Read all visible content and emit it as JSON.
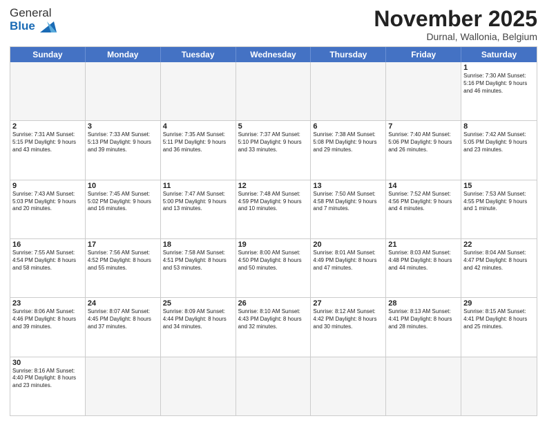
{
  "header": {
    "logo_general": "General",
    "logo_blue": "Blue",
    "month_title": "November 2025",
    "subtitle": "Durnal, Wallonia, Belgium"
  },
  "weekdays": [
    "Sunday",
    "Monday",
    "Tuesday",
    "Wednesday",
    "Thursday",
    "Friday",
    "Saturday"
  ],
  "rows": [
    [
      {
        "day": "",
        "info": "",
        "empty": true
      },
      {
        "day": "",
        "info": "",
        "empty": true
      },
      {
        "day": "",
        "info": "",
        "empty": true
      },
      {
        "day": "",
        "info": "",
        "empty": true
      },
      {
        "day": "",
        "info": "",
        "empty": true
      },
      {
        "day": "",
        "info": "",
        "empty": true
      },
      {
        "day": "1",
        "info": "Sunrise: 7:30 AM\nSunset: 5:16 PM\nDaylight: 9 hours and 46 minutes.",
        "empty": false
      }
    ],
    [
      {
        "day": "2",
        "info": "Sunrise: 7:31 AM\nSunset: 5:15 PM\nDaylight: 9 hours and 43 minutes.",
        "empty": false
      },
      {
        "day": "3",
        "info": "Sunrise: 7:33 AM\nSunset: 5:13 PM\nDaylight: 9 hours and 39 minutes.",
        "empty": false
      },
      {
        "day": "4",
        "info": "Sunrise: 7:35 AM\nSunset: 5:11 PM\nDaylight: 9 hours and 36 minutes.",
        "empty": false
      },
      {
        "day": "5",
        "info": "Sunrise: 7:37 AM\nSunset: 5:10 PM\nDaylight: 9 hours and 33 minutes.",
        "empty": false
      },
      {
        "day": "6",
        "info": "Sunrise: 7:38 AM\nSunset: 5:08 PM\nDaylight: 9 hours and 29 minutes.",
        "empty": false
      },
      {
        "day": "7",
        "info": "Sunrise: 7:40 AM\nSunset: 5:06 PM\nDaylight: 9 hours and 26 minutes.",
        "empty": false
      },
      {
        "day": "8",
        "info": "Sunrise: 7:42 AM\nSunset: 5:05 PM\nDaylight: 9 hours and 23 minutes.",
        "empty": false
      }
    ],
    [
      {
        "day": "9",
        "info": "Sunrise: 7:43 AM\nSunset: 5:03 PM\nDaylight: 9 hours and 20 minutes.",
        "empty": false
      },
      {
        "day": "10",
        "info": "Sunrise: 7:45 AM\nSunset: 5:02 PM\nDaylight: 9 hours and 16 minutes.",
        "empty": false
      },
      {
        "day": "11",
        "info": "Sunrise: 7:47 AM\nSunset: 5:00 PM\nDaylight: 9 hours and 13 minutes.",
        "empty": false
      },
      {
        "day": "12",
        "info": "Sunrise: 7:48 AM\nSunset: 4:59 PM\nDaylight: 9 hours and 10 minutes.",
        "empty": false
      },
      {
        "day": "13",
        "info": "Sunrise: 7:50 AM\nSunset: 4:58 PM\nDaylight: 9 hours and 7 minutes.",
        "empty": false
      },
      {
        "day": "14",
        "info": "Sunrise: 7:52 AM\nSunset: 4:56 PM\nDaylight: 9 hours and 4 minutes.",
        "empty": false
      },
      {
        "day": "15",
        "info": "Sunrise: 7:53 AM\nSunset: 4:55 PM\nDaylight: 9 hours and 1 minute.",
        "empty": false
      }
    ],
    [
      {
        "day": "16",
        "info": "Sunrise: 7:55 AM\nSunset: 4:54 PM\nDaylight: 8 hours and 58 minutes.",
        "empty": false
      },
      {
        "day": "17",
        "info": "Sunrise: 7:56 AM\nSunset: 4:52 PM\nDaylight: 8 hours and 55 minutes.",
        "empty": false
      },
      {
        "day": "18",
        "info": "Sunrise: 7:58 AM\nSunset: 4:51 PM\nDaylight: 8 hours and 53 minutes.",
        "empty": false
      },
      {
        "day": "19",
        "info": "Sunrise: 8:00 AM\nSunset: 4:50 PM\nDaylight: 8 hours and 50 minutes.",
        "empty": false
      },
      {
        "day": "20",
        "info": "Sunrise: 8:01 AM\nSunset: 4:49 PM\nDaylight: 8 hours and 47 minutes.",
        "empty": false
      },
      {
        "day": "21",
        "info": "Sunrise: 8:03 AM\nSunset: 4:48 PM\nDaylight: 8 hours and 44 minutes.",
        "empty": false
      },
      {
        "day": "22",
        "info": "Sunrise: 8:04 AM\nSunset: 4:47 PM\nDaylight: 8 hours and 42 minutes.",
        "empty": false
      }
    ],
    [
      {
        "day": "23",
        "info": "Sunrise: 8:06 AM\nSunset: 4:46 PM\nDaylight: 8 hours and 39 minutes.",
        "empty": false
      },
      {
        "day": "24",
        "info": "Sunrise: 8:07 AM\nSunset: 4:45 PM\nDaylight: 8 hours and 37 minutes.",
        "empty": false
      },
      {
        "day": "25",
        "info": "Sunrise: 8:09 AM\nSunset: 4:44 PM\nDaylight: 8 hours and 34 minutes.",
        "empty": false
      },
      {
        "day": "26",
        "info": "Sunrise: 8:10 AM\nSunset: 4:43 PM\nDaylight: 8 hours and 32 minutes.",
        "empty": false
      },
      {
        "day": "27",
        "info": "Sunrise: 8:12 AM\nSunset: 4:42 PM\nDaylight: 8 hours and 30 minutes.",
        "empty": false
      },
      {
        "day": "28",
        "info": "Sunrise: 8:13 AM\nSunset: 4:41 PM\nDaylight: 8 hours and 28 minutes.",
        "empty": false
      },
      {
        "day": "29",
        "info": "Sunrise: 8:15 AM\nSunset: 4:41 PM\nDaylight: 8 hours and 25 minutes.",
        "empty": false
      }
    ],
    [
      {
        "day": "30",
        "info": "Sunrise: 8:16 AM\nSunset: 4:40 PM\nDaylight: 8 hours and 23 minutes.",
        "empty": false
      },
      {
        "day": "",
        "info": "",
        "empty": true
      },
      {
        "day": "",
        "info": "",
        "empty": true
      },
      {
        "day": "",
        "info": "",
        "empty": true
      },
      {
        "day": "",
        "info": "",
        "empty": true
      },
      {
        "day": "",
        "info": "",
        "empty": true
      },
      {
        "day": "",
        "info": "",
        "empty": true
      }
    ]
  ]
}
